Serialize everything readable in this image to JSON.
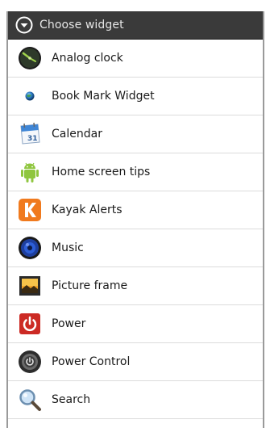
{
  "header": {
    "title": "Choose widget",
    "icon": "chevron-down-circle-icon"
  },
  "widgets": [
    {
      "label": "Analog clock",
      "icon": "analog-clock-icon"
    },
    {
      "label": "Book Mark Widget",
      "icon": "globe-dot-icon"
    },
    {
      "label": "Calendar",
      "icon": "calendar-icon"
    },
    {
      "label": "Home screen tips",
      "icon": "android-robot-icon"
    },
    {
      "label": "Kayak Alerts",
      "icon": "kayak-k-icon"
    },
    {
      "label": "Music",
      "icon": "speaker-icon"
    },
    {
      "label": "Picture frame",
      "icon": "picture-frame-icon"
    },
    {
      "label": "Power",
      "icon": "power-icon"
    },
    {
      "label": "Power Control",
      "icon": "power-control-icon"
    },
    {
      "label": "Search",
      "icon": "magnifier-icon"
    }
  ],
  "colors": {
    "header_bg": "#3a3a3a",
    "header_text": "#e6e6e6",
    "kayak_orange": "#f07a1e",
    "power_red": "#cc2a24",
    "android_green": "#8fc63f"
  }
}
